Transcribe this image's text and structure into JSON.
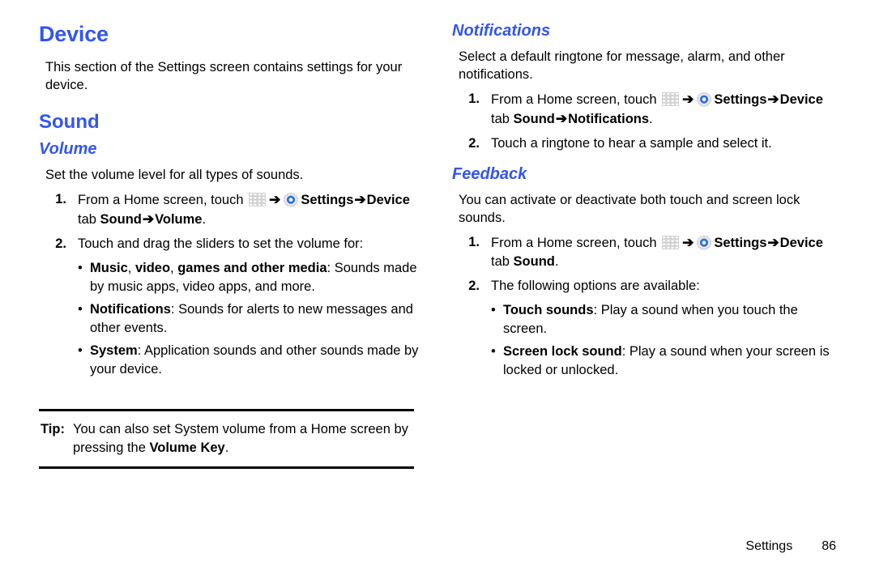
{
  "colors": {
    "heading_blue": "#3355ee",
    "body_black": "#000000",
    "rule_black": "#000000",
    "page_background": "#ffffff",
    "gear_blue": "#2f6fdf",
    "grid_gray": "#d0d0d0"
  },
  "icons": {
    "apps_grid": "apps-grid-icon",
    "settings_gear": "settings-gear-icon",
    "arrow": "➔"
  },
  "left_column": {
    "heading": "Device",
    "intro": "This section of the Settings screen contains settings for your device.",
    "section_heading": "Sound",
    "subsection_heading": "Volume",
    "subsection_intro": "Set the volume level for all types of sounds.",
    "steps": [
      {
        "number": "1.",
        "part1": "From a Home screen, touch ",
        "settings_label": "Settings",
        "part2": "Device",
        "part3": " tab ",
        "part4": "Sound",
        "part5": "Volume",
        "period": "."
      },
      {
        "number": "2.",
        "text": "Touch and drag the sliders to set the volume for:"
      }
    ],
    "bullets": [
      {
        "bold1": "Music",
        "sep1": ", ",
        "bold2": "video",
        "sep2": ", ",
        "bold3": "games and other media",
        "rest": ": Sounds made by music apps, video apps, and more."
      },
      {
        "bold1": "Notifications",
        "rest": ": Sounds for alerts to new messages and other events."
      },
      {
        "bold1": "System",
        "rest": ": Application sounds and other sounds made by your device."
      }
    ],
    "tip": {
      "label": "Tip:",
      "part1": " You can also set System volume from a Home screen by pressing the ",
      "bold": "Volume Key",
      "part2": "."
    }
  },
  "right_column": {
    "notifications": {
      "heading": "Notifications",
      "intro": "Select a default ringtone for message, alarm, and other notifications.",
      "steps": [
        {
          "number": "1.",
          "part1": "From a Home screen, touch ",
          "settings_label": "Settings",
          "part2": "Device",
          "part3": " tab ",
          "part4": "Sound",
          "part5": "Notifications",
          "period": "."
        },
        {
          "number": "2.",
          "text": "Touch a ringtone to hear a sample and select it."
        }
      ]
    },
    "feedback": {
      "heading": "Feedback",
      "intro": "You can activate or deactivate both touch and screen lock sounds.",
      "steps": [
        {
          "number": "1.",
          "part1": "From a Home screen, touch ",
          "settings_label": "Settings",
          "part2": "Device",
          "part3": " tab ",
          "part4": "Sound",
          "period": "."
        },
        {
          "number": "2.",
          "text": "The following options are available:"
        }
      ],
      "bullets": [
        {
          "bold1": "Touch sounds",
          "rest": ": Play a sound when you touch the screen."
        },
        {
          "bold1": "Screen lock sound",
          "rest": ": Play a sound when your screen is locked or unlocked."
        }
      ]
    }
  },
  "footer": {
    "label": "Settings",
    "page_number": "86"
  }
}
